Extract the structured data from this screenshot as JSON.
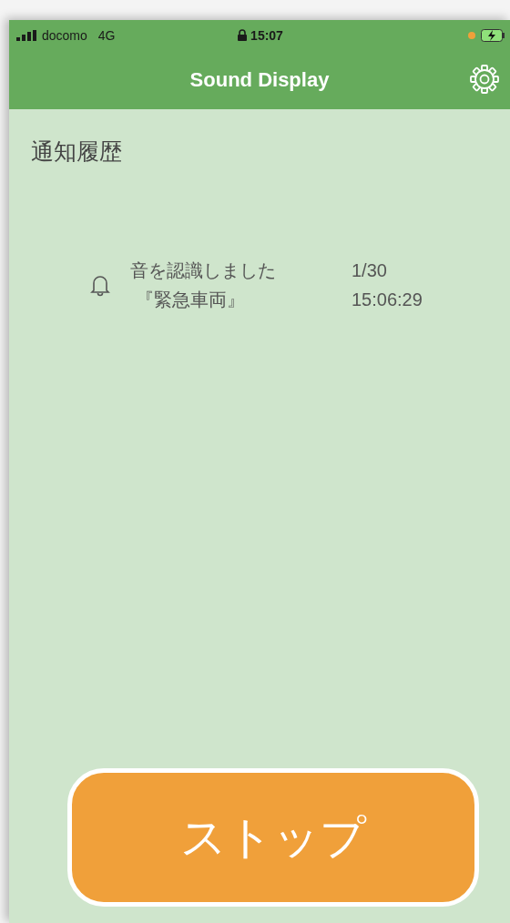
{
  "status_bar": {
    "carrier": "docomo",
    "network": "4G",
    "time": "15:07"
  },
  "nav_bar": {
    "title": "Sound Display"
  },
  "section_title": "通知履歴",
  "notifications": [
    {
      "message": "音を認識しました",
      "sound": "『緊急車両』",
      "date": "1/30",
      "time": "15:06:29"
    }
  ],
  "stop_button": {
    "label": "ストップ"
  }
}
